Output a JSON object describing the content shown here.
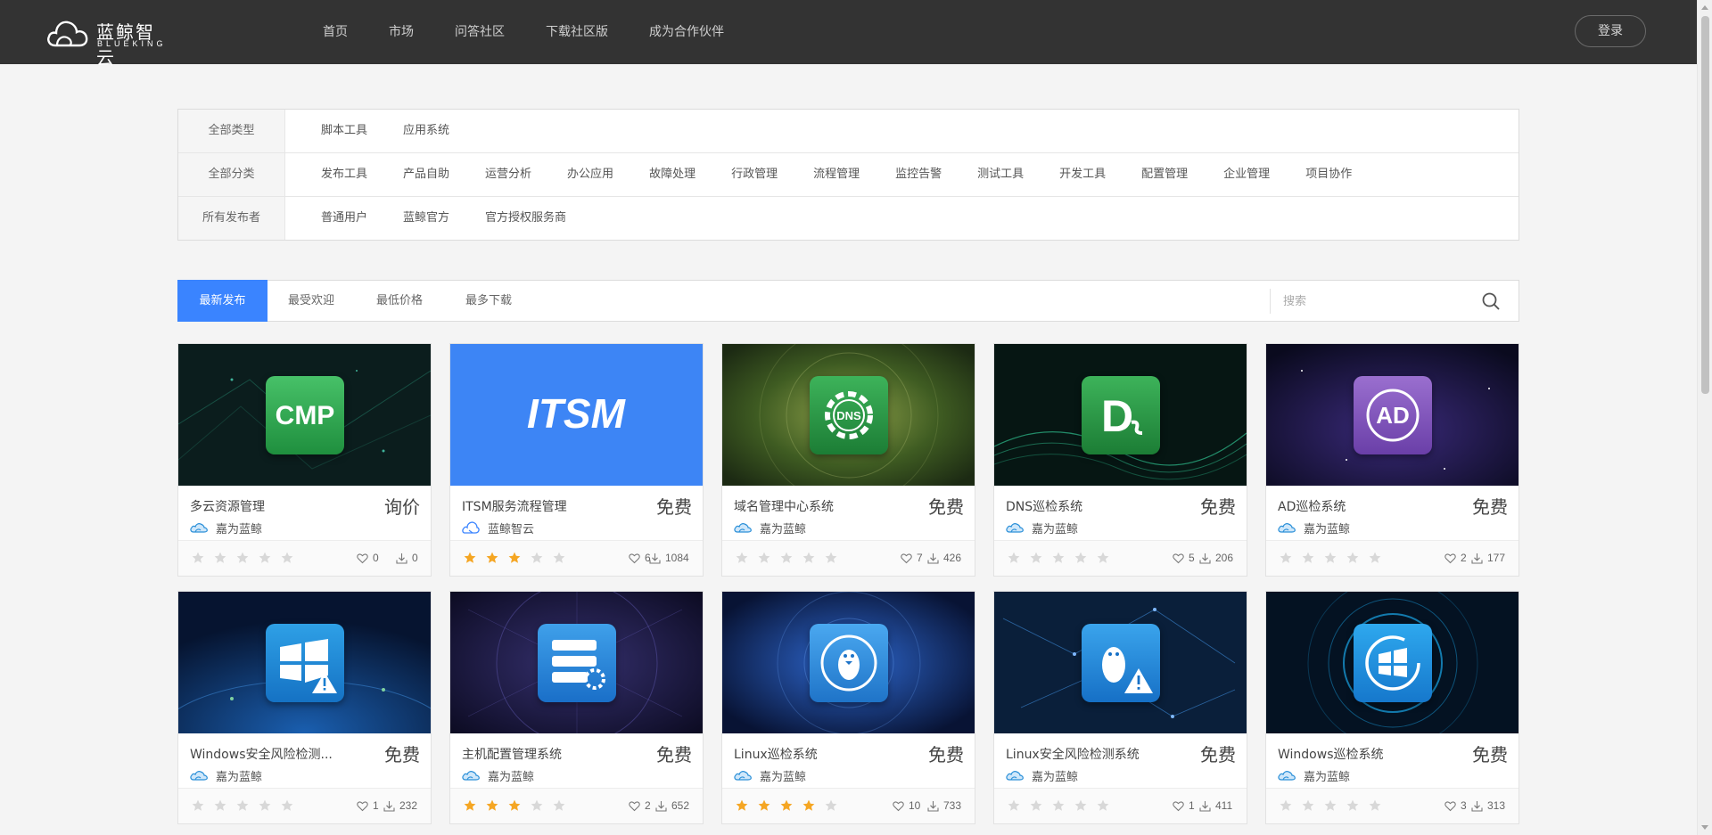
{
  "header": {
    "logo_cn": "蓝鲸智云",
    "logo_en": "BLUEKING",
    "nav": [
      "首页",
      "市场",
      "问答社区",
      "下载社区版",
      "成为合作伙伴"
    ],
    "login": "登录"
  },
  "filters": [
    {
      "label": "全部类型",
      "options": [
        "脚本工具",
        "应用系统"
      ]
    },
    {
      "label": "全部分类",
      "options": [
        "发布工具",
        "产品自助",
        "运营分析",
        "办公应用",
        "故障处理",
        "行政管理",
        "流程管理",
        "监控告警",
        "测试工具",
        "开发工具",
        "配置管理",
        "企业管理",
        "项目协作"
      ]
    },
    {
      "label": "所有发布者",
      "options": [
        "普通用户",
        "蓝鲸官方",
        "官方授权服务商"
      ]
    }
  ],
  "sort": {
    "tabs": [
      "最新发布",
      "最受欢迎",
      "最低价格",
      "最多下载"
    ],
    "active": "最新发布",
    "search_placeholder": "搜索"
  },
  "colors": {
    "accent": "#3a84ff",
    "star_on": "#f5a623",
    "star_off": "#d8d8d8",
    "topbar": "#333333"
  },
  "apps": [
    {
      "name": "多云资源管理",
      "price": "询价",
      "publisher": "嘉为蓝鲸",
      "rating": 0,
      "likes": "0",
      "downloads": "0",
      "icon": "cmp-icon",
      "bg": "dark-teal",
      "icon_label": "CMP"
    },
    {
      "name": "ITSM服务流程管理",
      "price": "免费",
      "publisher": "蓝鲸智云",
      "rating": 3,
      "likes": "6",
      "downloads": "1084",
      "icon": "itsm-logo",
      "bg": "blue",
      "icon_label": "ITSM"
    },
    {
      "name": "域名管理中心系统",
      "price": "免费",
      "publisher": "嘉为蓝鲸",
      "rating": 0,
      "likes": "7",
      "downloads": "426",
      "icon": "dns-gear-icon",
      "bg": "green-blur",
      "icon_label": "DNS"
    },
    {
      "name": "DNS巡检系统",
      "price": "免费",
      "publisher": "嘉为蓝鲸",
      "rating": 0,
      "likes": "5",
      "downloads": "206",
      "icon": "dns-letter-icon",
      "bg": "green-wave",
      "icon_label": "D"
    },
    {
      "name": "AD巡检系统",
      "price": "免费",
      "publisher": "嘉为蓝鲸",
      "rating": 0,
      "likes": "2",
      "downloads": "177",
      "icon": "ad-icon",
      "bg": "purple-space",
      "icon_label": "AD"
    },
    {
      "name": "Windows安全风险检测...",
      "price": "免费",
      "publisher": "嘉为蓝鲸",
      "rating": 0,
      "likes": "1",
      "downloads": "232",
      "icon": "windows-warning-icon",
      "bg": "blue-globe",
      "icon_label": ""
    },
    {
      "name": "主机配置管理系统",
      "price": "免费",
      "publisher": "嘉为蓝鲸",
      "rating": 3,
      "likes": "2",
      "downloads": "652",
      "icon": "server-gear-icon",
      "bg": "purple-network",
      "icon_label": ""
    },
    {
      "name": "Linux巡检系统",
      "price": "免费",
      "publisher": "嘉为蓝鲸",
      "rating": 4,
      "likes": "10",
      "downloads": "733",
      "icon": "linux-tux-icon",
      "bg": "blue-tunnel",
      "icon_label": ""
    },
    {
      "name": "Linux安全风险检测系统",
      "price": "免费",
      "publisher": "嘉为蓝鲸",
      "rating": 0,
      "likes": "1",
      "downloads": "411",
      "icon": "linux-warning-icon",
      "bg": "blue-network",
      "icon_label": ""
    },
    {
      "name": "Windows巡检系统",
      "price": "免费",
      "publisher": "嘉为蓝鲸",
      "rating": 0,
      "likes": "3",
      "downloads": "313",
      "icon": "windows-refresh-icon",
      "bg": "cyan-tech",
      "icon_label": ""
    }
  ]
}
